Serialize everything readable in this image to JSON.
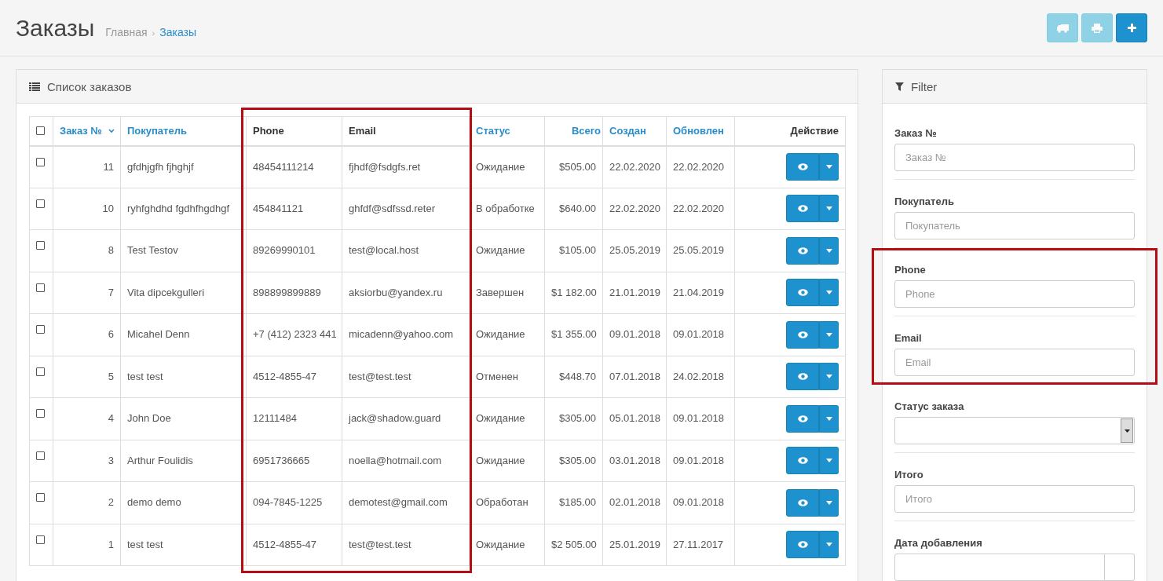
{
  "page": {
    "title": "Заказы",
    "breadcrumbs": [
      {
        "label": "Главная",
        "selected": false
      },
      {
        "label": "Заказы",
        "selected": true
      }
    ],
    "breadcrumb_separator": "›"
  },
  "toolbar": [
    {
      "kind": "truck",
      "tooltip_disabled": true
    },
    {
      "kind": "print",
      "tooltip_disabled": true
    },
    {
      "kind": "add",
      "tooltip_disabled": false
    }
  ],
  "orders": {
    "title": "Список заказов",
    "select_all": {
      "checked": false
    },
    "column_groups": [
      {
        "highlighted": false,
        "columns": [
          {
            "label": "Заказ №",
            "sortable": true,
            "sorted": true
          },
          {
            "label": "Покупатель",
            "sortable": true,
            "sorted": false
          }
        ]
      },
      {
        "highlighted": true,
        "columns": [
          {
            "label": "Phone",
            "sortable": false,
            "sorted": false
          },
          {
            "label": "Email",
            "sortable": false,
            "sorted": false
          }
        ]
      },
      {
        "highlighted": false,
        "columns": [
          {
            "label": "Статус",
            "sortable": true,
            "sorted": false
          },
          {
            "label": "Всего",
            "sortable": true,
            "sorted": false
          },
          {
            "label": "Создан",
            "sortable": true,
            "sorted": false
          },
          {
            "label": "Обновлен",
            "sortable": true,
            "sorted": false
          },
          {
            "label": "Действие",
            "sortable": false,
            "sorted": false
          }
        ]
      }
    ],
    "rows": [
      {
        "checked": false,
        "cells": [
          "11",
          "gfdhjgfh fjhghjf",
          "48454111214",
          "fjhdf@fsdgfs.ret",
          "Ожидание",
          "$505.00",
          "22.02.2020",
          "22.02.2020"
        ]
      },
      {
        "checked": false,
        "cells": [
          "10",
          "ryhfghdhd fgdhfhgdhgf",
          "454841121",
          "ghfdf@sdfssd.reter",
          "В обработке",
          "$640.00",
          "22.02.2020",
          "22.02.2020"
        ]
      },
      {
        "checked": false,
        "cells": [
          "8",
          "Test Testov",
          "89269990101",
          "test@local.host",
          "Ожидание",
          "$105.00",
          "25.05.2019",
          "25.05.2019"
        ]
      },
      {
        "checked": false,
        "cells": [
          "7",
          "Vita dipcekgulleri",
          "898899899889",
          "aksiorbu@yandex.ru",
          "Завершен",
          "$1 182.00",
          "21.01.2019",
          "21.04.2019"
        ]
      },
      {
        "checked": false,
        "cells": [
          "6",
          "Micahel Denn",
          "+7 (412) 2323 441",
          "micadenn@yahoo.com",
          "Ожидание",
          "$1 355.00",
          "09.01.2018",
          "09.01.2018"
        ]
      },
      {
        "checked": false,
        "cells": [
          "5",
          "test test",
          "4512-4855-47",
          "test@test.test",
          "Отменен",
          "$448.70",
          "07.01.2018",
          "24.02.2018"
        ]
      },
      {
        "checked": false,
        "cells": [
          "4",
          "John Doe",
          "12111484",
          "jack@shadow.guard",
          "Ожидание",
          "$305.00",
          "05.01.2018",
          "09.01.2018"
        ]
      },
      {
        "checked": false,
        "cells": [
          "3",
          "Arthur Foulidis",
          "6951736665",
          "noella@hotmail.com",
          "Ожидание",
          "$305.00",
          "03.01.2018",
          "09.01.2018"
        ]
      },
      {
        "checked": false,
        "cells": [
          "2",
          "demo demo",
          "094-7845-1225",
          "demotest@gmail.com",
          "Обработан",
          "$185.00",
          "02.01.2018",
          "09.01.2018"
        ]
      },
      {
        "checked": false,
        "cells": [
          "1",
          "test test",
          "4512-4855-47",
          "test@test.test",
          "Ожидание",
          "$2 505.00",
          "25.01.2019",
          "27.11.2017"
        ]
      }
    ]
  },
  "filter": {
    "title": "Filter",
    "field_groups": [
      {
        "highlighted": false,
        "fields": [
          {
            "kind": "text",
            "label": "Заказ №",
            "placeholder": "Заказ №"
          },
          {
            "kind": "text",
            "label": "Покупатель",
            "placeholder": "Покупатель"
          }
        ]
      },
      {
        "highlighted": true,
        "fields": [
          {
            "kind": "text",
            "label": "Phone",
            "placeholder": "Phone"
          },
          {
            "kind": "text",
            "label": "Email",
            "placeholder": "Email"
          }
        ]
      },
      {
        "highlighted": false,
        "fields": [
          {
            "kind": "select",
            "label": "Статус заказа"
          },
          {
            "kind": "text",
            "label": "Итого",
            "placeholder": "Итого"
          },
          {
            "kind": "date",
            "label": "Дата добавления"
          }
        ]
      }
    ]
  }
}
